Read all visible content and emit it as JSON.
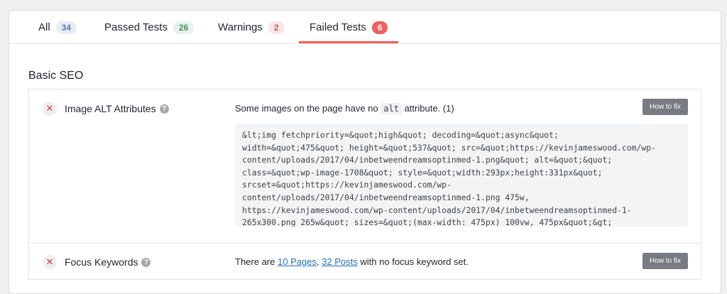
{
  "tabs": [
    {
      "label": "All",
      "count": "34"
    },
    {
      "label": "Passed Tests",
      "count": "26"
    },
    {
      "label": "Warnings",
      "count": "2"
    },
    {
      "label": "Failed Tests",
      "count": "6"
    }
  ],
  "active_tab": "Failed Tests",
  "section": {
    "title": "Basic SEO"
  },
  "tests": [
    {
      "status_icon": "close-icon",
      "name": "Image ALT Attributes",
      "message_pre": "Some images on the page have no",
      "message_code": "alt",
      "message_post": "attribute. (1)",
      "fix_label": "How to fix",
      "code": "&lt;img fetchpriority=&quot;high&quot; decoding=&quot;async&quot;\nwidth=&quot;475&quot; height=&quot;537&quot; src=&quot;https://kevinjameswood.com/wp-\ncontent/uploads/2017/04/inbetweendreamsoptinmed-1.png&quot; alt=&quot;&quot;\nclass=&quot;wp-image-1708&quot; style=&quot;width:293px;height:331px&quot;\nsrcset=&quot;https://kevinjameswood.com/wp-\ncontent/uploads/2017/04/inbetweendreamsoptinmed-1.png 475w,\nhttps://kevinjameswood.com/wp-content/uploads/2017/04/inbetweendreamsoptinmed-1-\n265x300.png 265w&quot; sizes=&quot;(max-width: 475px) 100vw, 475px&quot;&gt;"
    },
    {
      "status_icon": "close-icon",
      "name": "Focus Keywords",
      "message_pre": "There are",
      "link1": "10 Pages",
      "separator": ",",
      "link2": "32 Posts",
      "message_post": "with no focus keyword set.",
      "fix_label": "How to fix"
    }
  ],
  "colors": {
    "accent": "#f25f5c",
    "link": "#2271b1",
    "button": "#787c82"
  }
}
